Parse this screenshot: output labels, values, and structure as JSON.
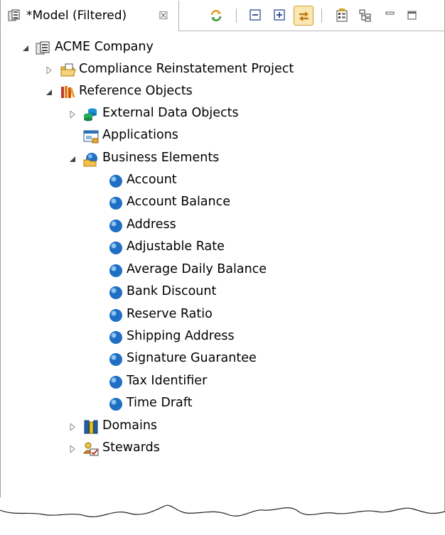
{
  "tab": {
    "title": "*Model (Filtered)",
    "icon": "model-icon",
    "close_icon": "close-x-icon"
  },
  "toolbar": {
    "buttons": [
      {
        "name": "sync-icon"
      },
      {
        "name": "collapse-all-icon"
      },
      {
        "name": "expand-all-icon"
      },
      {
        "name": "link-with-editor-icon",
        "pressed": true
      },
      {
        "name": "filter-icon"
      },
      {
        "name": "hierarchy-icon"
      },
      {
        "name": "minimize-icon"
      },
      {
        "name": "maximize-icon"
      }
    ]
  },
  "tree": {
    "root": "ACME Company",
    "project": "Compliance Reinstatement Project",
    "reference_objects": "Reference Objects",
    "external_data_objects": "External Data Objects",
    "applications": "Applications",
    "business_elements": "Business Elements",
    "elements": [
      "Account",
      "Account Balance",
      "Address",
      "Adjustable Rate",
      "Average Daily Balance",
      "Bank Discount",
      "Reserve Ratio",
      "Shipping Address",
      "Signature Guarantee",
      "Tax Identifier",
      "Time Draft"
    ],
    "domains": "Domains",
    "stewards": "Stewards"
  },
  "colors": {
    "accent_pressed": "#fbe7b4",
    "element_ball": "#1f6fc4"
  }
}
